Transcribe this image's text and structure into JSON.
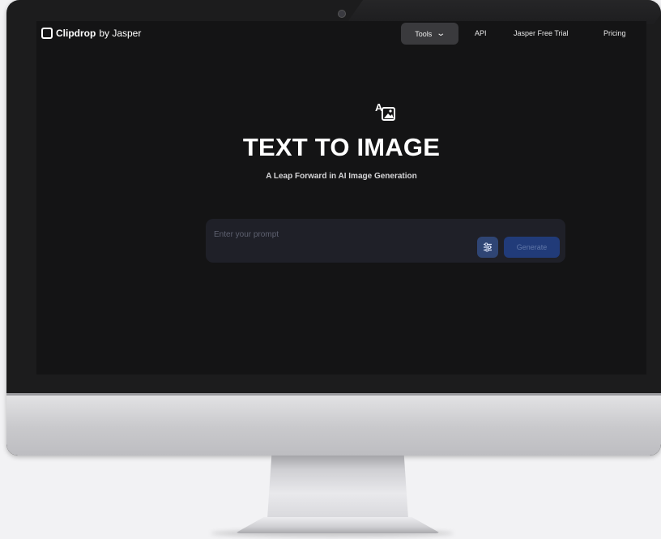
{
  "header": {
    "brand_name": "Clipdrop",
    "brand_suffix": "by Jasper",
    "nav": {
      "tools_label": "Tools",
      "api_label": "API",
      "trial_label": "Jasper Free Trial",
      "pricing_label": "Pricing"
    }
  },
  "hero": {
    "icon": "text-to-image-icon",
    "title": "TEXT TO IMAGE",
    "subtitle": "A Leap Forward in AI Image Generation"
  },
  "prompt": {
    "placeholder": "Enter your prompt",
    "value": "",
    "settings_icon": "sliders-icon",
    "generate_label": "Generate"
  },
  "colors": {
    "screen_bg": "#141415",
    "prompt_bg": "#1f2028",
    "accent": "#213b79",
    "tools_bg": "#3a3a3d"
  }
}
